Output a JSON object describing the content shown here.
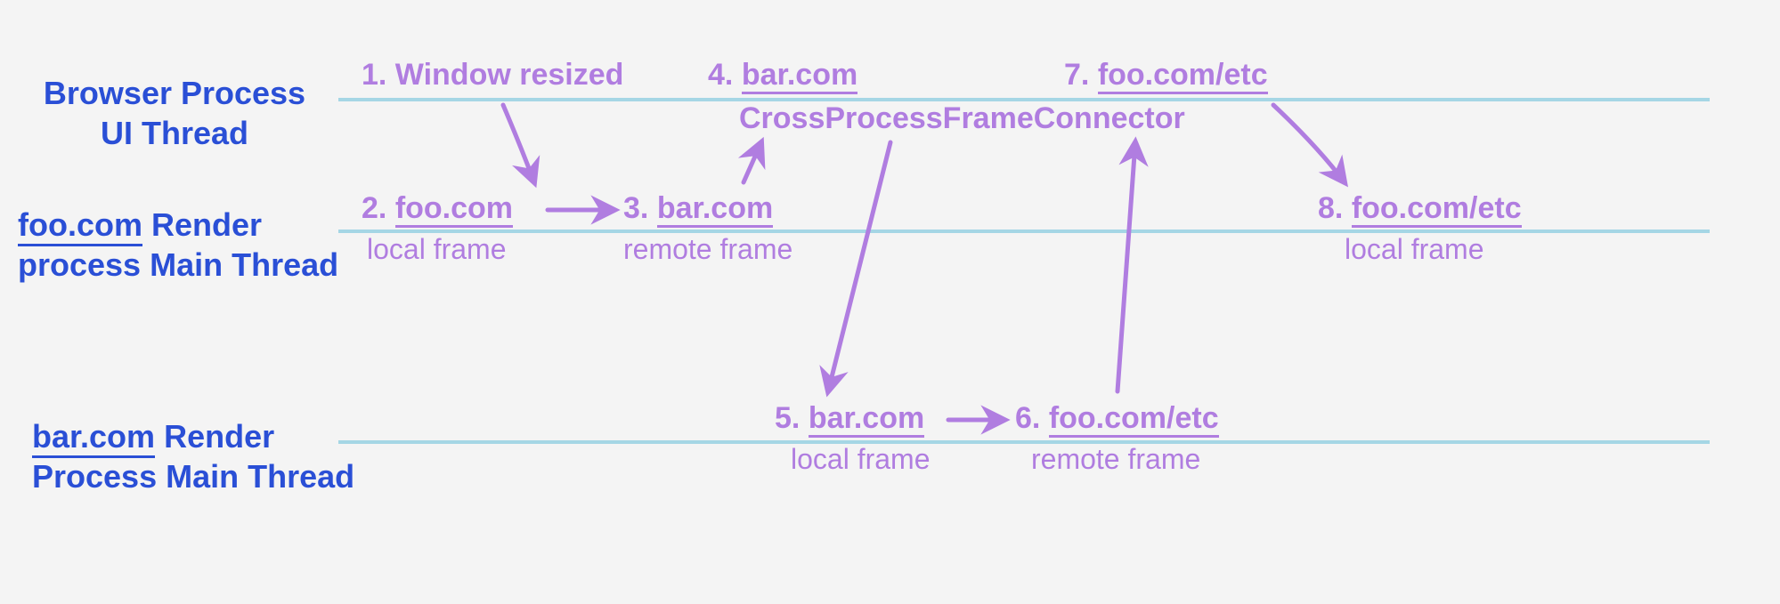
{
  "lanes": {
    "browser": {
      "line1": "Browser Process",
      "line2": "UI Thread"
    },
    "foo": {
      "prefix": "foo.com",
      "suffix": " Render",
      "line2": "process Main Thread"
    },
    "bar": {
      "prefix": "bar.com",
      "suffix": " Render",
      "line2": "Process Main Thread"
    }
  },
  "nodes": {
    "n1": {
      "label": "1. Window resized"
    },
    "n2": {
      "prefix": "2. ",
      "link": "foo.com",
      "sub": "local frame"
    },
    "n3": {
      "prefix": "3. ",
      "link": "bar.com",
      "sub": "remote frame"
    },
    "n4": {
      "prefix": "4. ",
      "link": "bar.com"
    },
    "cpfc": {
      "label": "CrossProcessFrameConnector"
    },
    "n5": {
      "prefix": "5. ",
      "link": "bar.com",
      "sub": "local frame"
    },
    "n6": {
      "prefix": "6. ",
      "link": "foo.com/etc",
      "sub": "remote frame"
    },
    "n7": {
      "prefix": "7. ",
      "link": "foo.com/etc"
    },
    "n8": {
      "prefix": "8. ",
      "link": "foo.com/etc",
      "sub": "local frame"
    }
  },
  "chart_data": {
    "type": "sequence_diagram",
    "lanes": [
      {
        "id": "browser_ui",
        "label": "Browser Process UI Thread"
      },
      {
        "id": "foo_render",
        "label": "foo.com Render process Main Thread"
      },
      {
        "id": "bar_render",
        "label": "bar.com Render Process Main Thread"
      }
    ],
    "events": [
      {
        "step": 1,
        "lane": "browser_ui",
        "label": "Window resized"
      },
      {
        "step": 2,
        "lane": "foo_render",
        "target": "foo.com",
        "role": "local frame"
      },
      {
        "step": 3,
        "lane": "foo_render",
        "target": "bar.com",
        "role": "remote frame"
      },
      {
        "step": 4,
        "lane": "browser_ui",
        "target": "bar.com",
        "via": "CrossProcessFrameConnector"
      },
      {
        "step": 5,
        "lane": "bar_render",
        "target": "bar.com",
        "role": "local frame"
      },
      {
        "step": 6,
        "lane": "bar_render",
        "target": "foo.com/etc",
        "role": "remote frame"
      },
      {
        "step": 7,
        "lane": "browser_ui",
        "target": "foo.com/etc",
        "via": "CrossProcessFrameConnector"
      },
      {
        "step": 8,
        "lane": "foo_render",
        "target": "foo.com/etc",
        "role": "local frame"
      }
    ],
    "transitions": [
      {
        "from": 1,
        "to": 2
      },
      {
        "from": 2,
        "to": 3
      },
      {
        "from": 3,
        "to": 4
      },
      {
        "from": 4,
        "to": 5
      },
      {
        "from": 5,
        "to": 6
      },
      {
        "from": 6,
        "to": 7
      },
      {
        "from": 7,
        "to": 8
      }
    ]
  }
}
